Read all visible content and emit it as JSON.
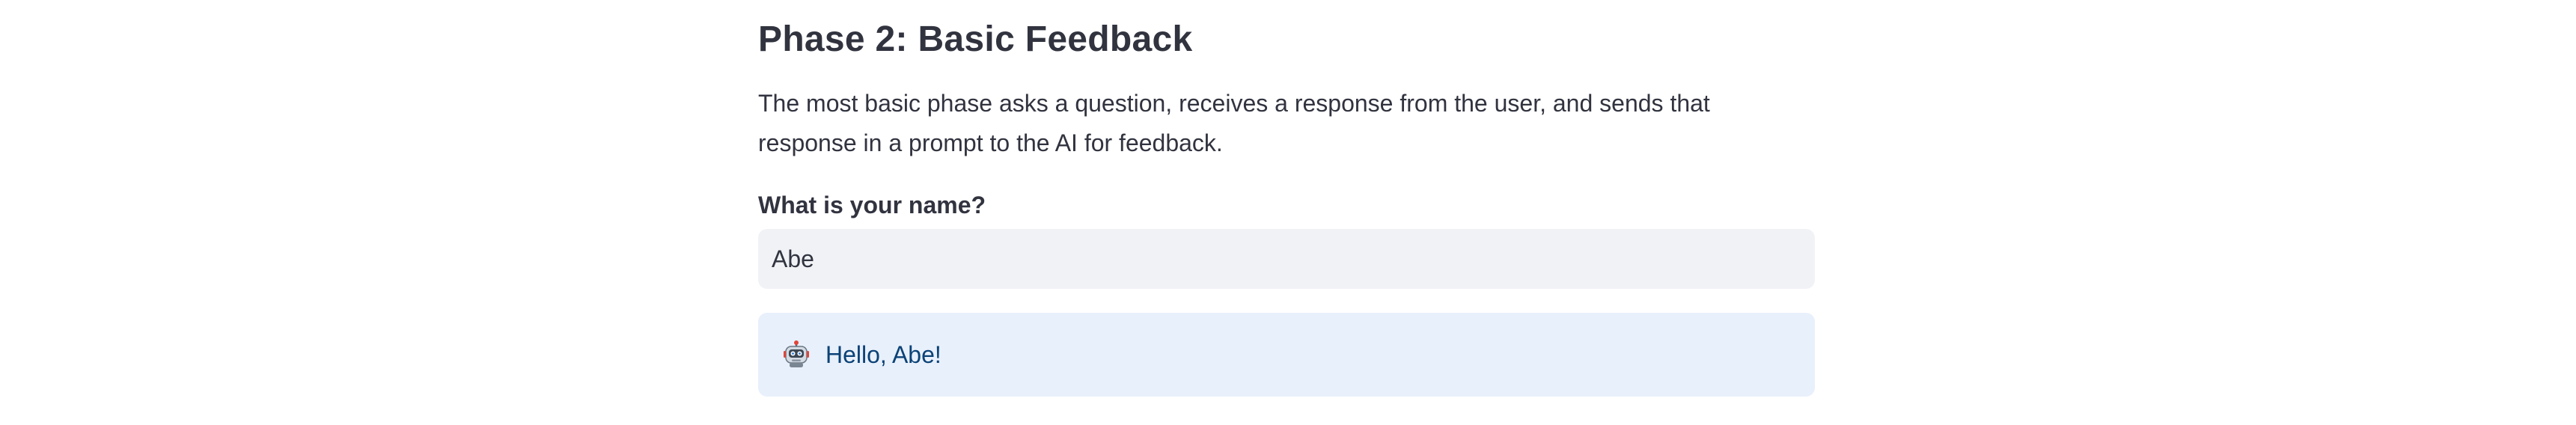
{
  "section": {
    "title": "Phase 2: Basic Feedback",
    "description": "The most basic phase asks a question, receives a response from the user, and sends that response in a prompt to the AI for feedback."
  },
  "question": {
    "label": "What is your name?",
    "value": "Abe"
  },
  "feedback": {
    "icon": "robot-icon",
    "message": "Hello, Abe!"
  },
  "colors": {
    "input_background": "#f0f2f6",
    "info_background": "#e8f0fb",
    "info_text": "#0b4277",
    "text": "#31333f"
  }
}
